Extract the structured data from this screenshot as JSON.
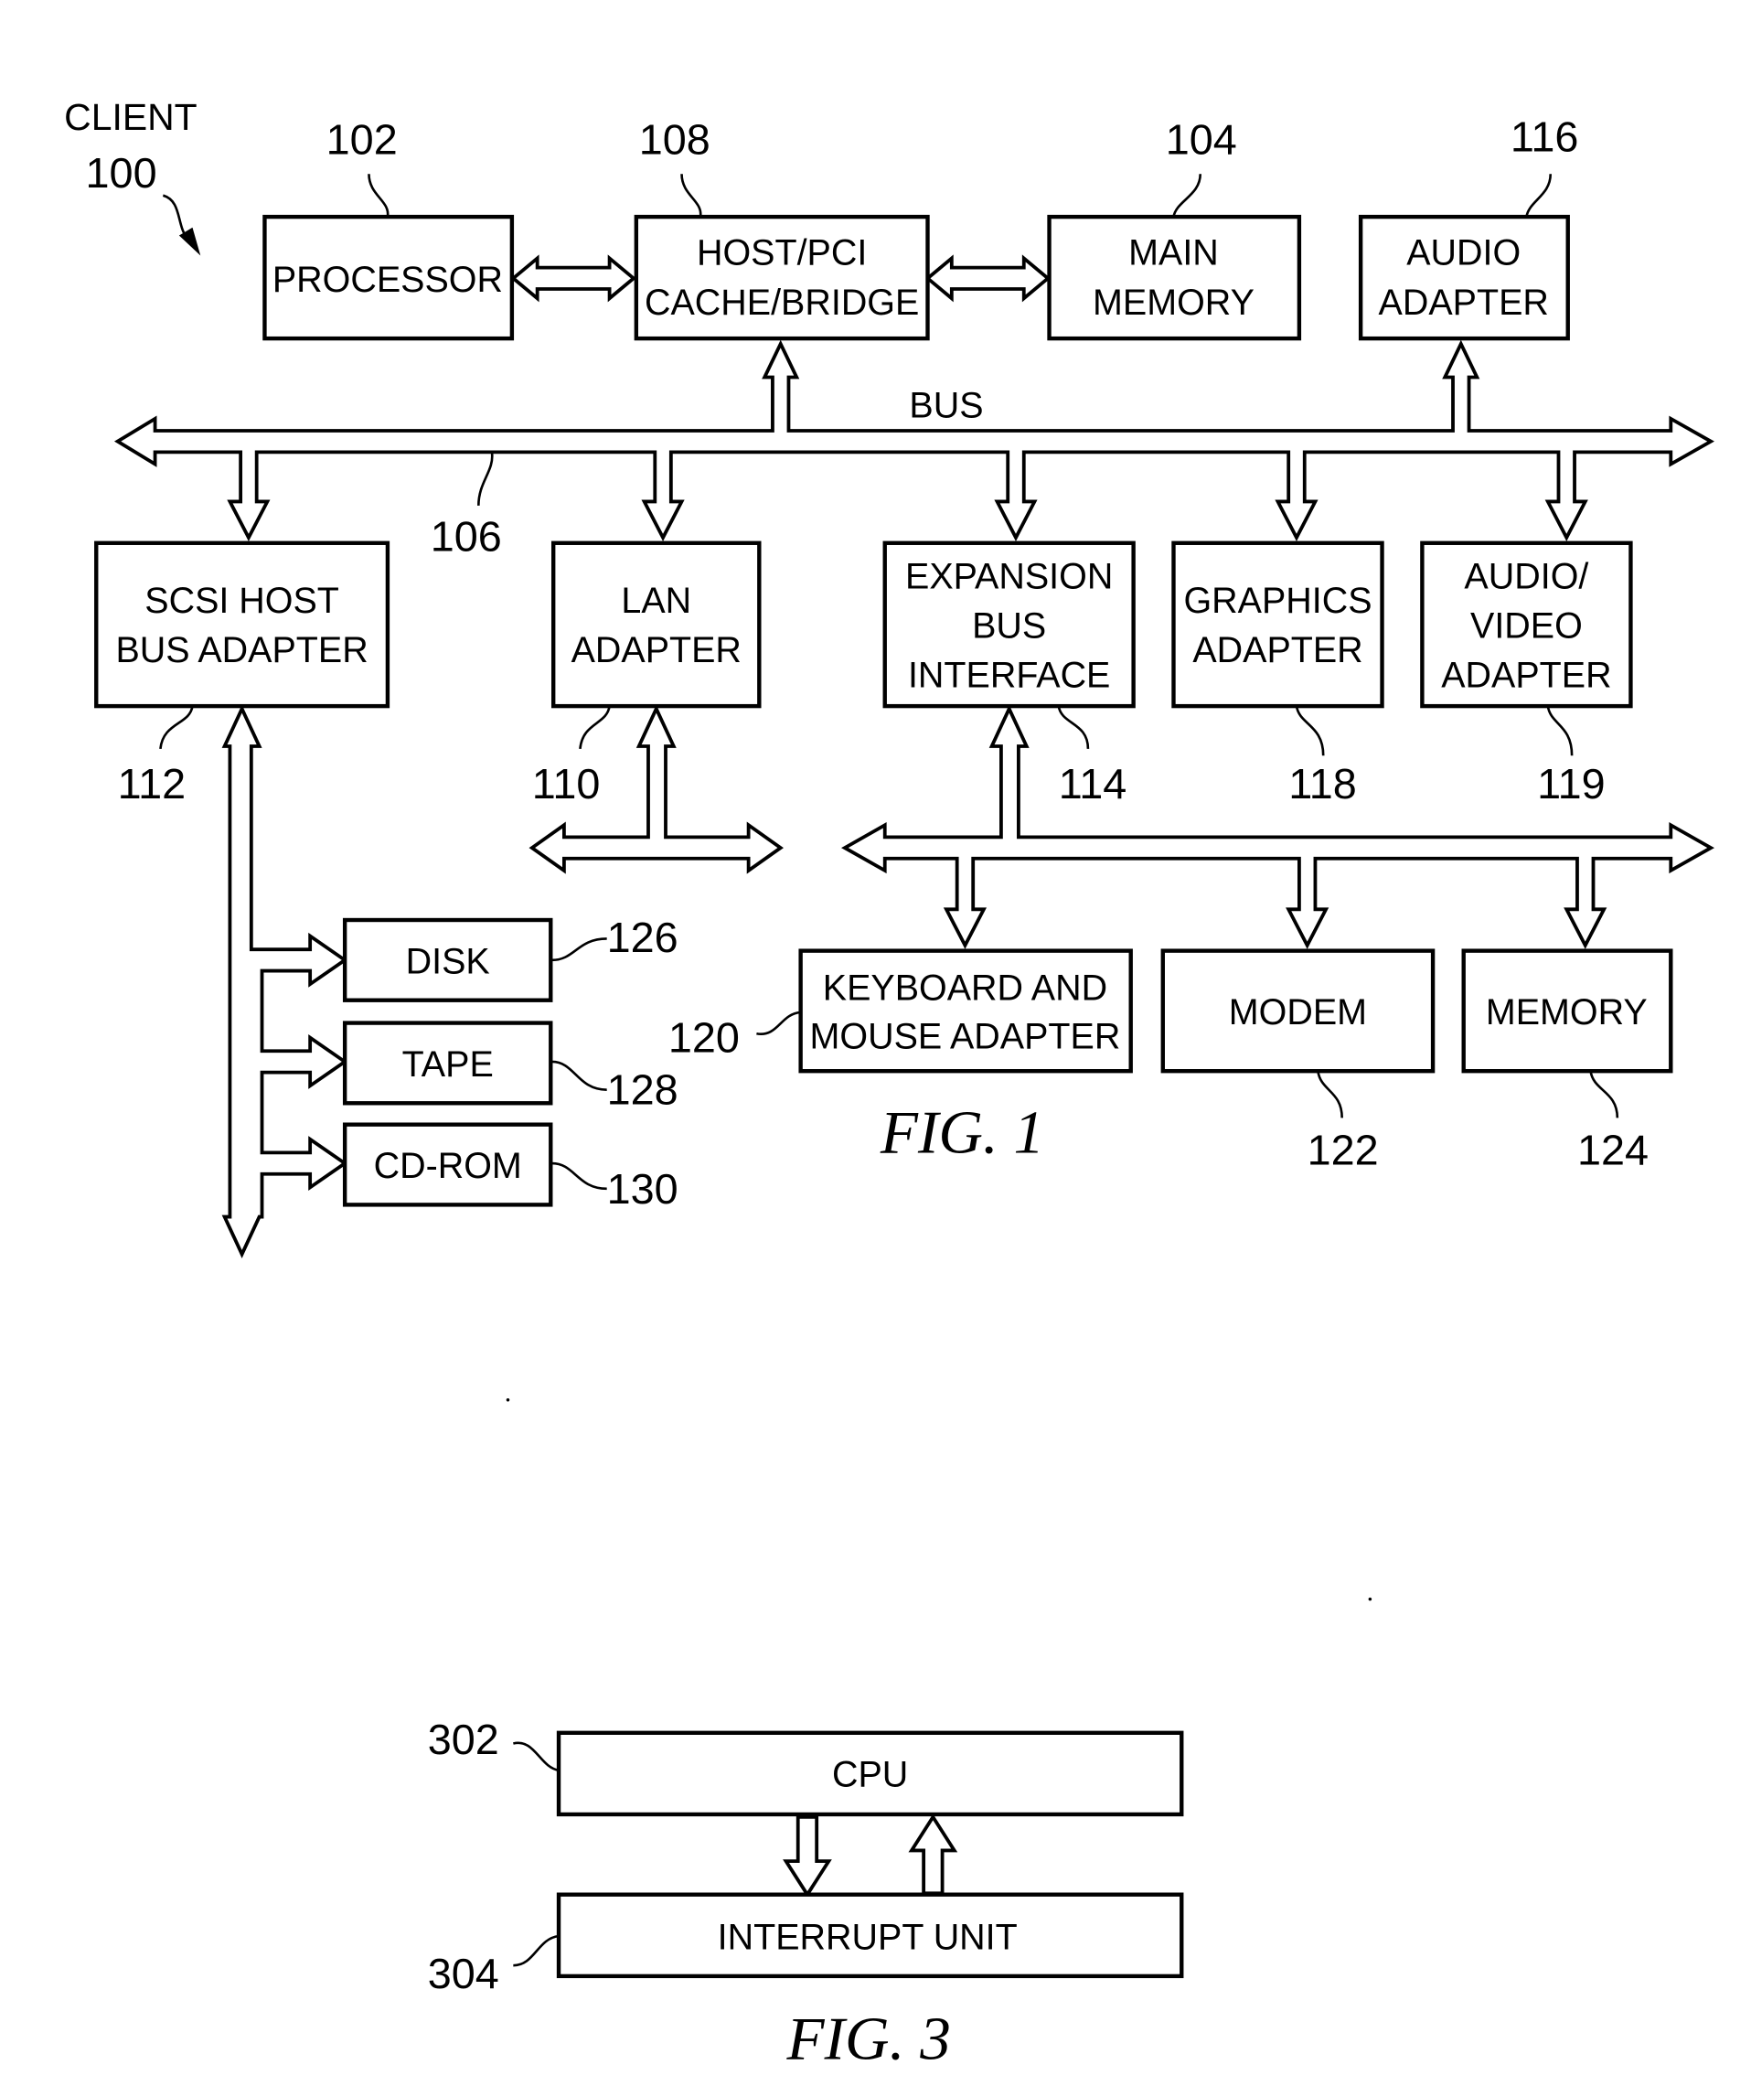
{
  "fig1": {
    "caption": "FIG. 1",
    "client_label": "CLIENT",
    "client_ref": "100",
    "bus_label": "BUS",
    "bus_ref": "106",
    "blocks": [
      {
        "id": "processor",
        "ref": "102",
        "lines": [
          "PROCESSOR"
        ]
      },
      {
        "id": "host-pci-bridge",
        "ref": "108",
        "lines": [
          "HOST/PCI",
          "CACHE/BRIDGE"
        ]
      },
      {
        "id": "main-memory",
        "ref": "104",
        "lines": [
          "MAIN",
          "MEMORY"
        ]
      },
      {
        "id": "audio-adapter",
        "ref": "116",
        "lines": [
          "AUDIO",
          "ADAPTER"
        ]
      },
      {
        "id": "scsi-host-bus-adapter",
        "ref": "112",
        "lines": [
          "SCSI HOST",
          "BUS ADAPTER"
        ]
      },
      {
        "id": "lan-adapter",
        "ref": "110",
        "lines": [
          "LAN",
          "ADAPTER"
        ]
      },
      {
        "id": "expansion-bus-interface",
        "ref": "114",
        "lines": [
          "EXPANSION",
          "BUS",
          "INTERFACE"
        ]
      },
      {
        "id": "graphics-adapter",
        "ref": "118",
        "lines": [
          "GRAPHICS",
          "ADAPTER"
        ]
      },
      {
        "id": "audio-video-adapter",
        "ref": "119",
        "lines": [
          "AUDIO/",
          "VIDEO",
          "ADAPTER"
        ]
      },
      {
        "id": "disk",
        "ref": "126",
        "lines": [
          "DISK"
        ]
      },
      {
        "id": "tape",
        "ref": "128",
        "lines": [
          "TAPE"
        ]
      },
      {
        "id": "cd-rom",
        "ref": "130",
        "lines": [
          "CD-ROM"
        ]
      },
      {
        "id": "keyboard-mouse-adapter",
        "ref": "120",
        "lines": [
          "KEYBOARD AND",
          "MOUSE ADAPTER"
        ]
      },
      {
        "id": "modem",
        "ref": "122",
        "lines": [
          "MODEM"
        ]
      },
      {
        "id": "memory",
        "ref": "124",
        "lines": [
          "MEMORY"
        ]
      }
    ]
  },
  "fig3": {
    "caption": "FIG. 3",
    "blocks": [
      {
        "id": "cpu",
        "ref": "302",
        "lines": [
          "CPU"
        ]
      },
      {
        "id": "interrupt-unit",
        "ref": "304",
        "lines": [
          "INTERRUPT UNIT"
        ]
      }
    ]
  }
}
